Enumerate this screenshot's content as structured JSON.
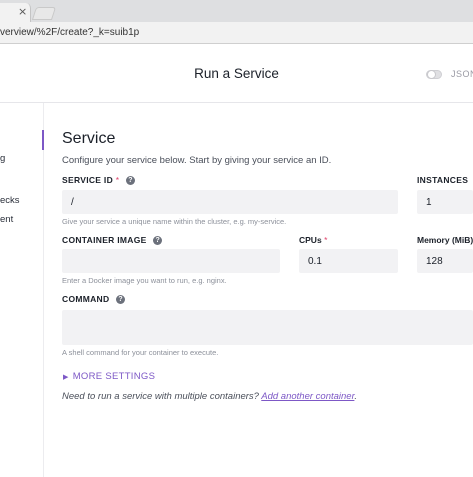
{
  "browser": {
    "tab_close": "×",
    "url": "verview/%2F/create?_k=suib1p"
  },
  "header": {
    "title": "Run a Service",
    "json_toggle_label": "JSON"
  },
  "nav": {
    "items": [
      {
        "label": "g"
      },
      {
        "label": "ecks"
      },
      {
        "label": "ent"
      }
    ]
  },
  "form": {
    "section_title": "Service",
    "section_desc": "Configure your service below. Start by giving your service an ID.",
    "service_id": {
      "label": "SERVICE ID",
      "required_mark": "*",
      "help_icon": "?",
      "value": "/",
      "hint": "Give your service a unique name within the cluster, e.g. my-service."
    },
    "instances": {
      "label": "INSTANCES",
      "value": "1"
    },
    "container_image": {
      "label": "CONTAINER IMAGE",
      "help_icon": "?",
      "value": "",
      "hint": "Enter a Docker image you want to run, e.g. nginx."
    },
    "cpus": {
      "label": "CPUs",
      "required_mark": "*",
      "value": "0.1"
    },
    "memory": {
      "label": "Memory (MiB)",
      "value": "128"
    },
    "command": {
      "label": "COMMAND",
      "help_icon": "?",
      "value": "",
      "hint": "A shell command for your container to execute."
    },
    "more_settings": {
      "caret": "▶",
      "label": "MORE SETTINGS"
    },
    "multi_container": {
      "prefix": "Need to run a service with multiple containers?",
      "link": "Add another container",
      "suffix": "."
    }
  },
  "colors": {
    "accent": "#7d58c6",
    "required": "#e0436b",
    "input_bg": "#f2f2f4"
  }
}
